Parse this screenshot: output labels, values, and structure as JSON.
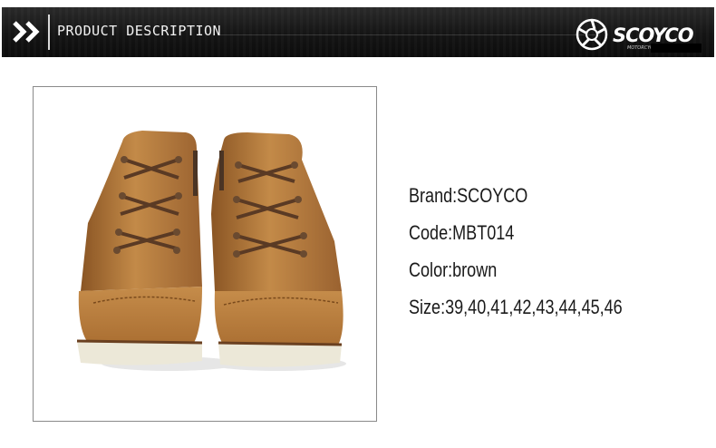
{
  "header": {
    "title": "PRODUCT DESCRIPTION",
    "logo_text": "SCOYCO",
    "logo_subtext": "MOTORCYCLE SPORTS",
    "chevron_icon": "double-chevron-right-icon"
  },
  "product": {
    "image": "boots-photo",
    "specs": {
      "brand": "Brand:SCOYCO",
      "code": "Code:MBT014",
      "color": "Color:brown",
      "size": "Size:39,40,41,42,43,44,45,46"
    }
  },
  "colors": {
    "header_bg": "#141414",
    "boot_leather": "#b07838",
    "sole": "#ece8d8"
  }
}
